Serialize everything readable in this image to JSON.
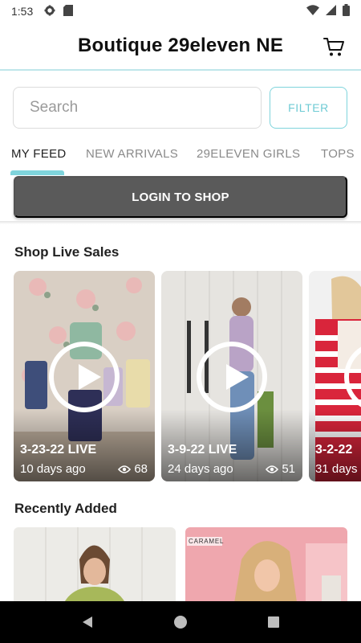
{
  "status_bar": {
    "time": "1:53"
  },
  "header": {
    "title": "Boutique 29eleven NE"
  },
  "search": {
    "placeholder": "Search",
    "filter_label": "FILTER"
  },
  "tabs": [
    {
      "label": "MY FEED"
    },
    {
      "label": "NEW ARRIVALS"
    },
    {
      "label": "29ELEVEN GIRLS"
    },
    {
      "label": "TOPS"
    }
  ],
  "login": {
    "label": "LOGIN TO SHOP"
  },
  "live_sales": {
    "title": "Shop Live Sales",
    "items": [
      {
        "title": "3-23-22 LIVE",
        "age": "10 days ago",
        "views": "68"
      },
      {
        "title": "3-9-22 LIVE",
        "age": "24 days ago",
        "views": "51"
      },
      {
        "title": "3-2-22",
        "age": "31 days"
      }
    ]
  },
  "recently_added": {
    "title": "Recently Added",
    "badge": "CARAMEL"
  },
  "colors": {
    "accent": "#7fd4dc",
    "login_bg": "#5a5a5a"
  }
}
